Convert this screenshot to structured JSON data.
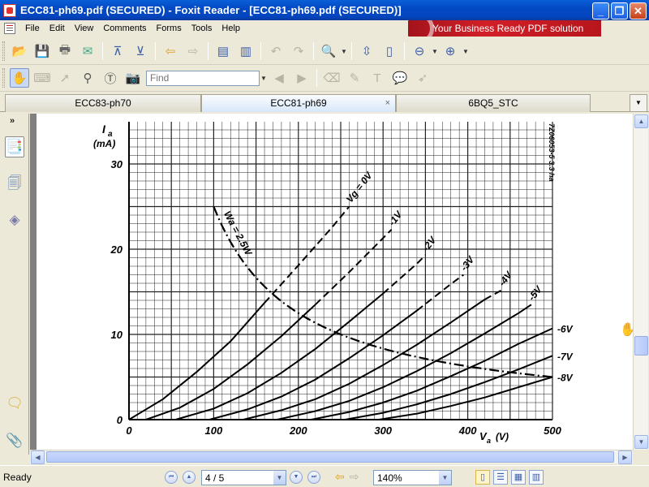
{
  "window": {
    "title": "ECC81-ph69.pdf (SECURED) - Foxit Reader - [ECC81-ph69.pdf (SECURED)]"
  },
  "menu": [
    "File",
    "Edit",
    "View",
    "Comments",
    "Forms",
    "Tools",
    "Help"
  ],
  "banner": "Your Business Ready PDF solution",
  "find": {
    "placeholder": "Find"
  },
  "tabs": [
    {
      "label": "ECC83-ph70",
      "active": false
    },
    {
      "label": "ECC81-ph69",
      "active": true,
      "close": "×"
    },
    {
      "label": "6BQ5_STC",
      "active": false
    }
  ],
  "status": {
    "text": "Ready",
    "page": "4 / 5",
    "zoom": "140%"
  },
  "icons": {
    "open": "folder-open-icon",
    "save": "save-icon",
    "print": "printer-icon",
    "email": "email-icon",
    "prev": "arrow-up-icon",
    "next": "arrow-down-icon",
    "back": "arrow-left-icon",
    "forward": "arrow-right-icon",
    "hand": "hand-icon",
    "zoom": "magnifier-icon"
  },
  "chart_data": {
    "type": "line",
    "ylabel_symbol": "I",
    "ylabel_sub": "a",
    "yunit": "(mA)",
    "xlabel_symbol": "V",
    "xlabel_sub": "a",
    "xunit": "(V)",
    "side_code": "7Z06053-5 3.3 ha",
    "xlim": [
      0,
      500
    ],
    "ylim": [
      0,
      35
    ],
    "x_ticks": [
      "0",
      "100",
      "200",
      "300",
      "400",
      "500"
    ],
    "y_ticks": [
      "0",
      "10",
      "20",
      "30"
    ],
    "grid": true,
    "series": [
      {
        "name": "Vg = 0V",
        "points": [
          [
            0,
            0
          ],
          [
            40,
            2.4
          ],
          [
            80,
            5.6
          ],
          [
            120,
            9.2
          ],
          [
            160,
            13.7
          ],
          [
            200,
            18.1
          ],
          [
            240,
            22.6
          ],
          [
            260,
            25
          ]
        ]
      },
      {
        "name": "-1V",
        "points": [
          [
            20,
            0
          ],
          [
            60,
            1.4
          ],
          [
            100,
            3.6
          ],
          [
            140,
            6.5
          ],
          [
            180,
            9.8
          ],
          [
            220,
            13.5
          ],
          [
            260,
            17.3
          ],
          [
            300,
            21.3
          ],
          [
            310,
            22.3
          ]
        ]
      },
      {
        "name": "-2V",
        "points": [
          [
            55,
            0
          ],
          [
            100,
            1.3
          ],
          [
            140,
            3.1
          ],
          [
            180,
            5.5
          ],
          [
            220,
            8.3
          ],
          [
            260,
            11.5
          ],
          [
            300,
            14.8
          ],
          [
            340,
            18.3
          ],
          [
            350,
            19.3
          ]
        ]
      },
      {
        "name": "-3V",
        "points": [
          [
            95,
            0
          ],
          [
            140,
            1.2
          ],
          [
            180,
            2.7
          ],
          [
            220,
            4.7
          ],
          [
            260,
            7.2
          ],
          [
            300,
            9.9
          ],
          [
            340,
            12.8
          ],
          [
            380,
            15.9
          ],
          [
            395,
            17
          ]
        ]
      },
      {
        "name": "-4V",
        "points": [
          [
            135,
            0
          ],
          [
            180,
            1.1
          ],
          [
            220,
            2.4
          ],
          [
            260,
            4.2
          ],
          [
            300,
            6.4
          ],
          [
            340,
            8.8
          ],
          [
            380,
            11.4
          ],
          [
            420,
            14.1
          ],
          [
            440,
            15.2
          ]
        ]
      },
      {
        "name": "-5V",
        "points": [
          [
            175,
            0
          ],
          [
            220,
            1
          ],
          [
            260,
            2.2
          ],
          [
            300,
            3.8
          ],
          [
            340,
            5.7
          ],
          [
            380,
            7.8
          ],
          [
            420,
            10.1
          ],
          [
            460,
            12.5
          ],
          [
            475,
            13.5
          ]
        ]
      },
      {
        "name": "-6V",
        "points": [
          [
            215,
            0
          ],
          [
            260,
            0.9
          ],
          [
            300,
            2
          ],
          [
            340,
            3.4
          ],
          [
            380,
            5.1
          ],
          [
            420,
            6.9
          ],
          [
            460,
            8.9
          ],
          [
            500,
            10.7
          ]
        ]
      },
      {
        "name": "-7V",
        "points": [
          [
            255,
            0
          ],
          [
            300,
            0.8
          ],
          [
            340,
            1.8
          ],
          [
            380,
            3
          ],
          [
            420,
            4.4
          ],
          [
            460,
            5.9
          ],
          [
            500,
            7.5
          ]
        ]
      },
      {
        "name": "-8V",
        "points": [
          [
            295,
            0
          ],
          [
            340,
            0.7
          ],
          [
            380,
            1.6
          ],
          [
            420,
            2.6
          ],
          [
            460,
            3.8
          ],
          [
            500,
            5
          ]
        ]
      }
    ],
    "power_curve": {
      "name": "Wa = 2.5W",
      "watts": 2.5,
      "x_range": [
        100,
        500
      ]
    },
    "dashed_above_y": 15
  }
}
